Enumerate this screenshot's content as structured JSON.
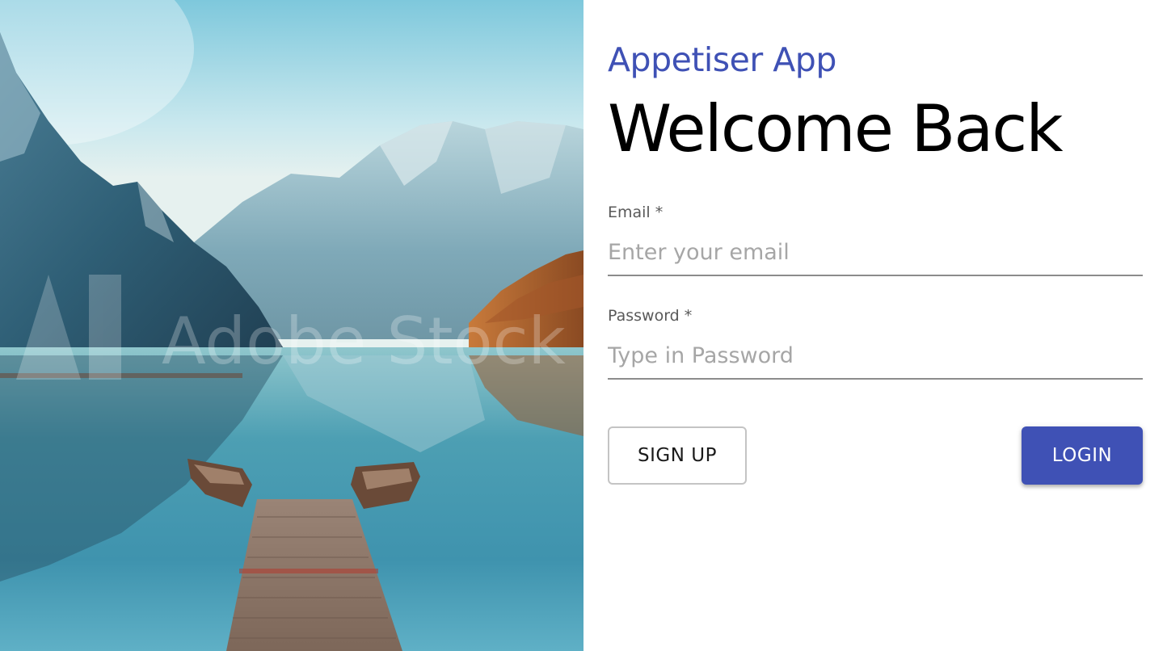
{
  "hero": {
    "watermark_text": "Adobe Stock",
    "image_description_icon": "mountain-lake-photo"
  },
  "login": {
    "app_name": "Appetiser App",
    "heading": "Welcome Back",
    "email": {
      "label": "Email *",
      "placeholder": "Enter your email",
      "value": ""
    },
    "password": {
      "label": "Password *",
      "placeholder": "Type in Password",
      "value": ""
    },
    "signup_label": "SIGN UP",
    "login_label": "LOGIN"
  },
  "colors": {
    "accent": "#3f51b5",
    "text": "#000000",
    "label": "#595959",
    "placeholder": "#a6a6a6"
  }
}
